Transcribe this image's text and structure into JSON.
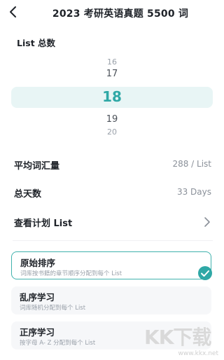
{
  "header": {
    "title": "2023 考研英语真题 5500 词",
    "back_icon": "chevron-left-icon"
  },
  "list_total": {
    "label": "List 总数",
    "options": [
      "16",
      "17",
      "18",
      "19",
      "20"
    ],
    "selected": "18"
  },
  "stats": {
    "avg_label": "平均词汇量",
    "avg_value": "288 / List",
    "days_label": "总天数",
    "days_value": "33 Days",
    "plan_label": "查看计划 List"
  },
  "sort_options": [
    {
      "title": "原始排序",
      "desc": "词库按书籍的章节顺序分配到每个 List",
      "selected": true
    },
    {
      "title": "乱序学习",
      "desc": "词库随机分配到每个 List",
      "selected": false
    },
    {
      "title": "正序学习",
      "desc": "按字母 A- Z 分配到每个 List",
      "selected": false
    }
  ],
  "watermark": {
    "logo": "KK下载",
    "url": "www.kkx.net"
  },
  "colors": {
    "accent": "#2fa8a6",
    "selected_bg": "#e8f5f5",
    "text": "#1f2329",
    "muted": "#9aa1aa"
  }
}
